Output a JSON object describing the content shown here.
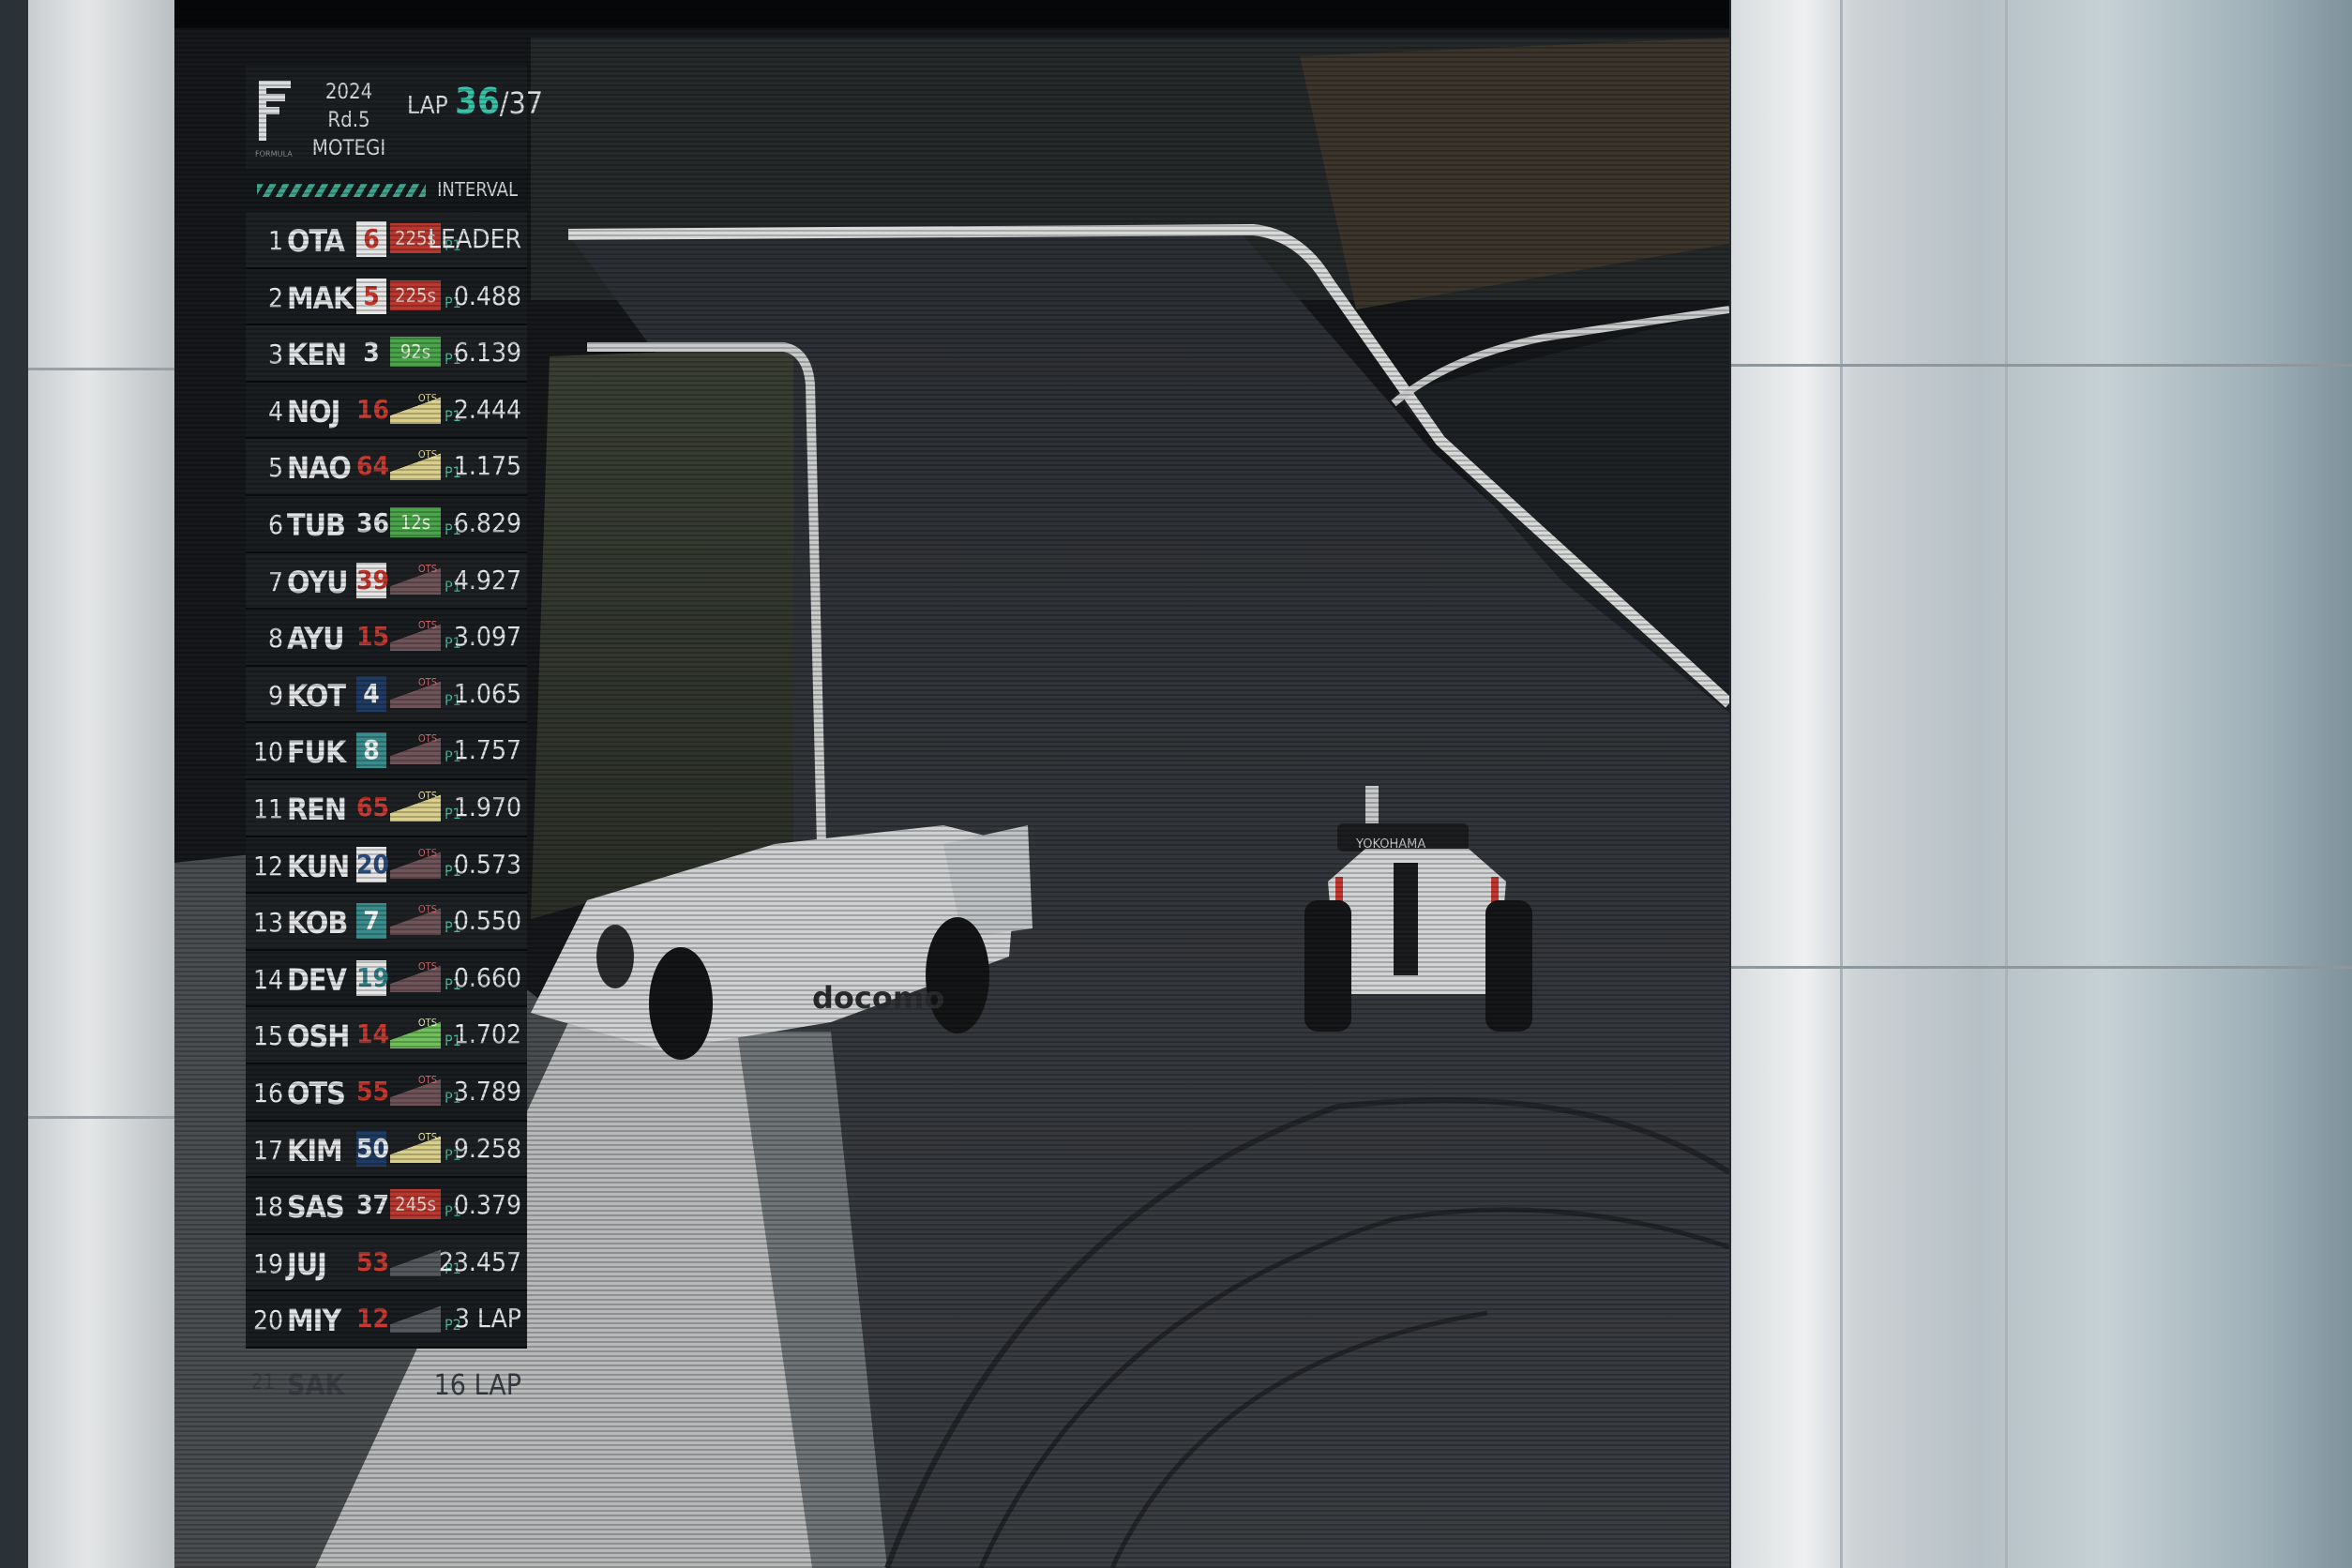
{
  "tower": {
    "logo_caption": "FORMULA",
    "event_line1": "2024 Rd.5",
    "event_line2": "MOTEGI",
    "lap_label": "LAP",
    "lap_current": "36",
    "lap_separator": "/",
    "lap_total": "37",
    "interval_header": "INTERVAL",
    "rows": [
      {
        "pos": "1",
        "driver": "OTA",
        "number": "6",
        "number_style": "white-red",
        "indicator": "225s",
        "indicator_style": "red",
        "class": "P1",
        "interval": "LEADER"
      },
      {
        "pos": "2",
        "driver": "MAK",
        "number": "5",
        "number_style": "white-red",
        "indicator": "225s",
        "indicator_style": "red",
        "class": "P1",
        "interval": "0.488"
      },
      {
        "pos": "3",
        "driver": "KEN",
        "number": "3",
        "number_style": "plain",
        "indicator": "92s",
        "indicator_style": "green",
        "class": "P1",
        "interval": "6.139"
      },
      {
        "pos": "4",
        "driver": "NOJ",
        "number": "16",
        "number_style": "red-text",
        "indicator": "OTS",
        "indicator_style": "ots-yellow",
        "class": "P1",
        "interval": "2.444"
      },
      {
        "pos": "5",
        "driver": "NAO",
        "number": "64",
        "number_style": "red-text",
        "indicator": "OTS",
        "indicator_style": "ots-yellow",
        "class": "P1",
        "interval": "1.175"
      },
      {
        "pos": "6",
        "driver": "TUB",
        "number": "36",
        "number_style": "plain",
        "indicator": "12s",
        "indicator_style": "green",
        "class": "P1",
        "interval": "6.829"
      },
      {
        "pos": "7",
        "driver": "OYU",
        "number": "39",
        "number_style": "white-red",
        "indicator": "OTS",
        "indicator_style": "ots-red",
        "class": "P1",
        "interval": "4.927"
      },
      {
        "pos": "8",
        "driver": "AYU",
        "number": "15",
        "number_style": "red-text",
        "indicator": "OTS",
        "indicator_style": "ots-red",
        "class": "P1",
        "interval": "3.097"
      },
      {
        "pos": "9",
        "driver": "KOT",
        "number": "4",
        "number_style": "navy",
        "indicator": "OTS",
        "indicator_style": "ots-red",
        "class": "P1",
        "interval": "1.065"
      },
      {
        "pos": "10",
        "driver": "FUK",
        "number": "8",
        "number_style": "teal",
        "indicator": "OTS",
        "indicator_style": "ots-red",
        "class": "P1",
        "interval": "1.757"
      },
      {
        "pos": "11",
        "driver": "REN",
        "number": "65",
        "number_style": "red-text",
        "indicator": "OTS",
        "indicator_style": "ots-yellow",
        "class": "P1",
        "interval": "1.970"
      },
      {
        "pos": "12",
        "driver": "KUN",
        "number": "20",
        "number_style": "white-navy",
        "indicator": "OTS",
        "indicator_style": "ots-red",
        "class": "P1",
        "interval": "0.573"
      },
      {
        "pos": "13",
        "driver": "KOB",
        "number": "7",
        "number_style": "teal",
        "indicator": "OTS",
        "indicator_style": "ots-red",
        "class": "P1",
        "interval": "0.550"
      },
      {
        "pos": "14",
        "driver": "DEV",
        "number": "19",
        "number_style": "white-teal",
        "indicator": "OTS",
        "indicator_style": "ots-red",
        "class": "P1",
        "interval": "0.660"
      },
      {
        "pos": "15",
        "driver": "OSH",
        "number": "14",
        "number_style": "red-text",
        "indicator": "OTS",
        "indicator_style": "ots-green",
        "class": "P1",
        "interval": "1.702"
      },
      {
        "pos": "16",
        "driver": "OTS",
        "number": "55",
        "number_style": "red-text",
        "indicator": "OTS",
        "indicator_style": "ots-red",
        "class": "P1",
        "interval": "3.789"
      },
      {
        "pos": "17",
        "driver": "KIM",
        "number": "50",
        "number_style": "navy",
        "indicator": "OTS",
        "indicator_style": "ots-yellow",
        "class": "P1",
        "interval": "9.258"
      },
      {
        "pos": "18",
        "driver": "SAS",
        "number": "37",
        "number_style": "plain",
        "indicator": "245s",
        "indicator_style": "red",
        "class": "P1",
        "interval": "0.379"
      },
      {
        "pos": "19",
        "driver": "JUJ",
        "number": "53",
        "number_style": "red-text",
        "indicator": "",
        "indicator_style": "ots-grey",
        "class": "P1",
        "interval": "23.457"
      },
      {
        "pos": "20",
        "driver": "MIY",
        "number": "12",
        "number_style": "red-text",
        "indicator": "",
        "indicator_style": "ots-grey",
        "class": "P2",
        "interval": "3 LAP"
      }
    ],
    "ghost_row": {
      "pos": "21",
      "driver": "SAK",
      "interval": "16 LAP"
    }
  },
  "video": {
    "car_left_sponsor": "docomo",
    "car_right_sponsor": "YOKOHAMA"
  },
  "colors": {
    "teal_accent": "#37c4a9",
    "red_indicator": "#b8372f",
    "green_indicator": "#4aa44a",
    "tower_bg": "#1a1d20"
  }
}
